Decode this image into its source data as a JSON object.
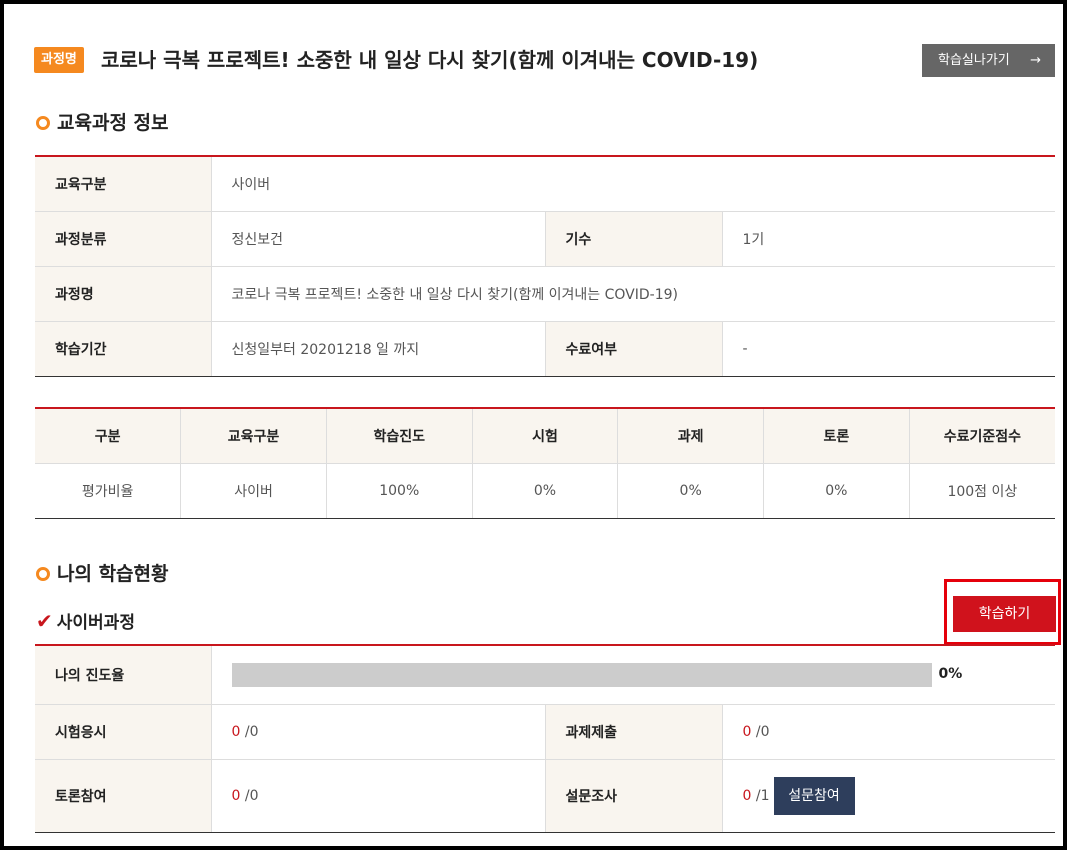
{
  "header": {
    "badge": "과정명",
    "course_title": "코로나 극복 프로젝트! 소중한 내 일상 다시 찾기(함께 이겨내는 COVID-19)",
    "go_button": "학습실나가기",
    "go_arrow": "→"
  },
  "edu_info": {
    "heading": "교육과정 정보",
    "rows": [
      {
        "label": "교육구분",
        "value": "사이버"
      },
      {
        "label": "과정분류",
        "value": "정신보건",
        "label2": "기수",
        "value2": "1기"
      },
      {
        "label": "과정명",
        "value": "코로나 극복 프로젝트! 소중한 내 일상 다시 찾기(함께 이겨내는 COVID-19)"
      },
      {
        "label": "학습기간",
        "value": "신청일부터 20201218 일 까지",
        "label2": "수료여부",
        "value2": "-"
      }
    ]
  },
  "rates": {
    "headers": [
      "구분",
      "교육구분",
      "학습진도",
      "시험",
      "과제",
      "토론",
      "수료기준점수"
    ],
    "row": [
      "평가비율",
      "사이버",
      "100%",
      "0%",
      "0%",
      "0%",
      "100점 이상"
    ]
  },
  "my_status": {
    "heading": "나의 학습현황",
    "sub_heading": "사이버과정",
    "check_icon": "✔",
    "study_button": "학습하기",
    "progress_label": "나의 진도율",
    "progress_percent_text": "0%",
    "progress_value": 0,
    "exam_label": "시험응시",
    "exam_done": "0",
    "exam_total": "/0",
    "assign_label": "과제제출",
    "assign_done": "0",
    "assign_total": "/0",
    "discuss_label": "토론참여",
    "discuss_done": "0",
    "discuss_total": "/0",
    "survey_label": "설문조사",
    "survey_done": "0",
    "survey_total": "/1",
    "survey_button": "설문참여"
  },
  "colors": {
    "accent_orange": "#f5891f",
    "accent_red": "#c8161d",
    "highlight_box": "#e5000b",
    "survey_button_bg": "#2e3e5c",
    "header_cell_bg": "#f9f5ef"
  }
}
